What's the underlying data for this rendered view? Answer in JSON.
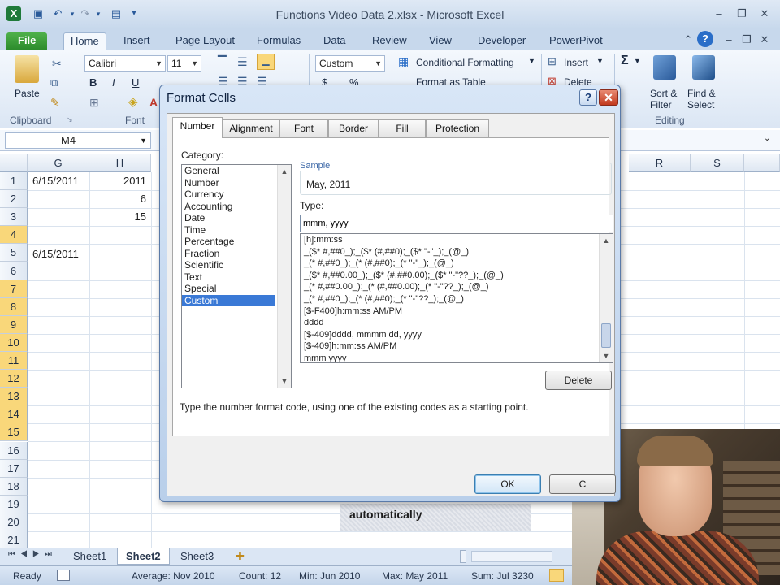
{
  "window": {
    "title": "Functions Video Data 2.xlsx - Microsoft Excel"
  },
  "ribbon_tabs": [
    "File",
    "Home",
    "Insert",
    "Page Layout",
    "Formulas",
    "Data",
    "Review",
    "View",
    "Developer",
    "PowerPivot"
  ],
  "ribbon": {
    "clipboard": {
      "paste": "Paste",
      "group": "Clipboard"
    },
    "font": {
      "name": "Calibri",
      "size": "11",
      "bold": "B",
      "italic": "I",
      "underline": "U",
      "group": "Font"
    },
    "number": {
      "format": "Custom",
      "currency": "$",
      "percent": "%"
    },
    "styles": {
      "conditional_formatting": "Conditional Formatting",
      "format_as_table": "Format as Table"
    },
    "cells": {
      "insert": "Insert",
      "delete": "Delete"
    },
    "editing": {
      "sum": "Σ",
      "sort_filter_1": "Sort &",
      "sort_filter_2": "Filter",
      "find_select_1": "Find &",
      "find_select_2": "Select",
      "group": "Editing"
    }
  },
  "formula_bar": {
    "name_box": "M4"
  },
  "grid": {
    "columns": [
      {
        "label": "G"
      },
      {
        "label": "H"
      },
      {
        "label": "R"
      },
      {
        "label": "S"
      }
    ],
    "rows": [
      "1",
      "2",
      "3",
      "4",
      "5",
      "6",
      "7",
      "8",
      "9",
      "10",
      "11",
      "12",
      "13",
      "14",
      "15",
      "16",
      "17",
      "18",
      "19",
      "20",
      "21"
    ],
    "cells": [
      {
        "row": 1,
        "col": "G",
        "value": "6/15/2011"
      },
      {
        "row": 1,
        "col": "H",
        "value": "2011"
      },
      {
        "row": 2,
        "col": "H",
        "value": "6"
      },
      {
        "row": 3,
        "col": "H",
        "value": "15"
      },
      {
        "row": 5,
        "col": "G",
        "value": "6/15/2011"
      }
    ]
  },
  "sheet_tabs": [
    "Sheet1",
    "Sheet2",
    "Sheet3"
  ],
  "active_sheet": "Sheet2",
  "status_bar": {
    "ready": "Ready",
    "average": "Average: Nov 2010",
    "count": "Count: 12",
    "min": "Min: Jun 2010",
    "max": "Max: May 2011",
    "sum": "Sum: Jul 3230"
  },
  "dialog": {
    "title": "Format Cells",
    "help": "?",
    "close": "✕",
    "tabs": [
      "Number",
      "Alignment",
      "Font",
      "Border",
      "Fill",
      "Protection"
    ],
    "active_tab": "Number",
    "category_label": "Category:",
    "categories": [
      "General",
      "Number",
      "Currency",
      "Accounting",
      "Date",
      "Time",
      "Percentage",
      "Fraction",
      "Scientific",
      "Text",
      "Special",
      "Custom"
    ],
    "selected_category": "Custom",
    "sample_label": "Sample",
    "sample_value": "May, 2011",
    "type_label": "Type:",
    "type_value": "mmm, yyyy",
    "type_list": [
      "[h]:mm:ss",
      "_($* #,##0_);_($* (#,##0);_($* \"-\"_);_(@_)",
      "_(* #,##0_);_(* (#,##0);_(* \"-\"_);_(@_)",
      "_($* #,##0.00_);_($* (#,##0.00);_($* \"-\"??_);_(@_)",
      "_(* #,##0.00_);_(* (#,##0.00);_(* \"-\"??_);_(@_)",
      "_(* #,##0_);_(* (#,##0);_(* \"-\"??_);_(@_)",
      "[$-F400]h:mm:ss AM/PM",
      "dddd",
      "[$-409]dddd, mmmm dd, yyyy",
      "[$-409]h:mm:ss AM/PM",
      "mmm yyyy"
    ],
    "delete": "Delete",
    "hint": "Type the number format code, using one of the existing codes as a starting point.",
    "ok": "OK",
    "cancel": "C"
  },
  "overlay_note": "automatically"
}
